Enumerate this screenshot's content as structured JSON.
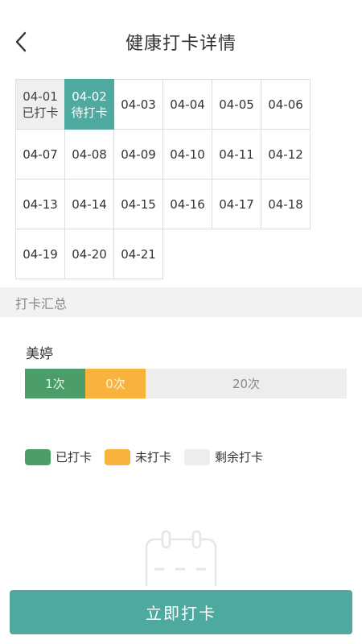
{
  "header": {
    "title": "健康打卡详情",
    "back_icon": "chevron-left-icon"
  },
  "calendar": {
    "days": [
      {
        "date": "04-01",
        "status": "已打卡",
        "state": "done"
      },
      {
        "date": "04-02",
        "status": "待打卡",
        "state": "pending"
      },
      {
        "date": "04-03",
        "status": "",
        "state": "none"
      },
      {
        "date": "04-04",
        "status": "",
        "state": "none"
      },
      {
        "date": "04-05",
        "status": "",
        "state": "none"
      },
      {
        "date": "04-06",
        "status": "",
        "state": "none"
      },
      {
        "date": "04-07",
        "status": "",
        "state": "none"
      },
      {
        "date": "04-08",
        "status": "",
        "state": "none"
      },
      {
        "date": "04-09",
        "status": "",
        "state": "none"
      },
      {
        "date": "04-10",
        "status": "",
        "state": "none"
      },
      {
        "date": "04-11",
        "status": "",
        "state": "none"
      },
      {
        "date": "04-12",
        "status": "",
        "state": "none"
      },
      {
        "date": "04-13",
        "status": "",
        "state": "none"
      },
      {
        "date": "04-14",
        "status": "",
        "state": "none"
      },
      {
        "date": "04-15",
        "status": "",
        "state": "none"
      },
      {
        "date": "04-16",
        "status": "",
        "state": "none"
      },
      {
        "date": "04-17",
        "status": "",
        "state": "none"
      },
      {
        "date": "04-18",
        "status": "",
        "state": "none"
      },
      {
        "date": "04-19",
        "status": "",
        "state": "none"
      },
      {
        "date": "04-20",
        "status": "",
        "state": "none"
      },
      {
        "date": "04-21",
        "status": "",
        "state": "none"
      }
    ]
  },
  "summary": {
    "title": "打卡汇总",
    "person": "美婷",
    "bar": {
      "done": "1次",
      "missed": "0次",
      "remaining": "20次"
    }
  },
  "legend": {
    "done": "已打卡",
    "missed": "未打卡",
    "remaining": "剩余打卡"
  },
  "colors": {
    "accent": "#4ea99f",
    "done": "#4b9e6a",
    "missed": "#f9b33c",
    "remaining": "#ededed"
  },
  "action": {
    "checkin_label": "立即打卡"
  }
}
